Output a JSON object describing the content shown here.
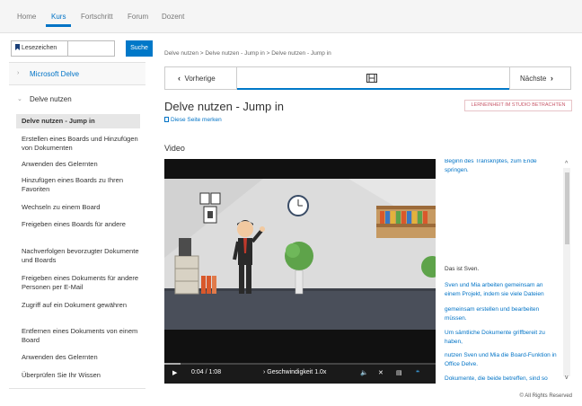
{
  "topnav": {
    "tabs": [
      {
        "label": "Home"
      },
      {
        "label": "Kurs"
      },
      {
        "label": "Fortschritt"
      },
      {
        "label": "Forum"
      },
      {
        "label": "Dozent"
      }
    ],
    "active": "Kurs"
  },
  "sidebar": {
    "bookmarks_label": "Lesezeichen",
    "search_placeholder": "",
    "search_button": "Suche",
    "section1": "Microsoft Delve",
    "section2": "Delve nutzen",
    "items": [
      {
        "label": "Delve nutzen - Jump in",
        "active": true
      },
      {
        "label": "Erstellen eines Boards und Hinzufügen von Dokumenten"
      },
      {
        "label": "Anwenden des Gelernten"
      },
      {
        "label": "Hinzufügen eines Boards zu Ihren Favoriten"
      },
      {
        "label": "Wechseln zu einem Board"
      },
      {
        "label": "Freigeben eines Boards für andere"
      },
      {
        "label": "Nachverfolgen bevorzugter Dokumente und Boards"
      },
      {
        "label": "Freigeben eines Dokuments für andere Personen per E-Mail"
      },
      {
        "label": "Zugriff auf ein Dokument gewähren"
      },
      {
        "label": "Entfernen eines Dokuments von einem Board"
      },
      {
        "label": "Anwenden des Gelernten"
      },
      {
        "label": "Überprüfen Sie Ihr Wissen"
      }
    ]
  },
  "main": {
    "breadcrumb": "Delve nutzen > Delve nutzen - Jump in > Delve nutzen - Jump in",
    "prev_label": "Vorherige",
    "next_label": "Nächste",
    "title": "Delve nutzen - Jump in",
    "save_link": "Diese Seite merken",
    "studio_button": "LERNEINHEIT IM STUDIO BETRACHTEN",
    "video_heading": "Video"
  },
  "video": {
    "time": "0:04 / 1:08",
    "speed_label": "Geschwindigkeit",
    "speed_value": "1.0x",
    "progress": 0.06
  },
  "transcript": {
    "lines": [
      {
        "text": "Beginn des Transkriptes, zum Ende springen.",
        "dark": false
      },
      {
        "text": "Das ist Sven.",
        "dark": true
      },
      {
        "text": "Sven und Mia arbeiten gemeinsam an einem Projekt, indem sie viele Dateien",
        "dark": false
      },
      {
        "text": "gemeinsam erstellen und bearbeiten müssen.",
        "dark": false
      },
      {
        "text": "Um sämtliche Dokumente griffbereit zu haben,",
        "dark": false
      },
      {
        "text": "nutzen Sven und Mia die Board-Funktion in Office Delve.",
        "dark": false
      },
      {
        "text": "Dokumente, die beide betreffen, sind so",
        "dark": false
      }
    ]
  },
  "footer": "© All Rights Reserved",
  "colors": {
    "accent": "#0078c8",
    "studio": "#c8596a"
  },
  "icons": {
    "bookmark": "bookmark-icon",
    "film": "film-icon",
    "play": "play-icon",
    "volume": "volume-icon",
    "fullscreen": "fullscreen-icon",
    "transcript": "transcript-icon",
    "captions": "captions-icon"
  }
}
